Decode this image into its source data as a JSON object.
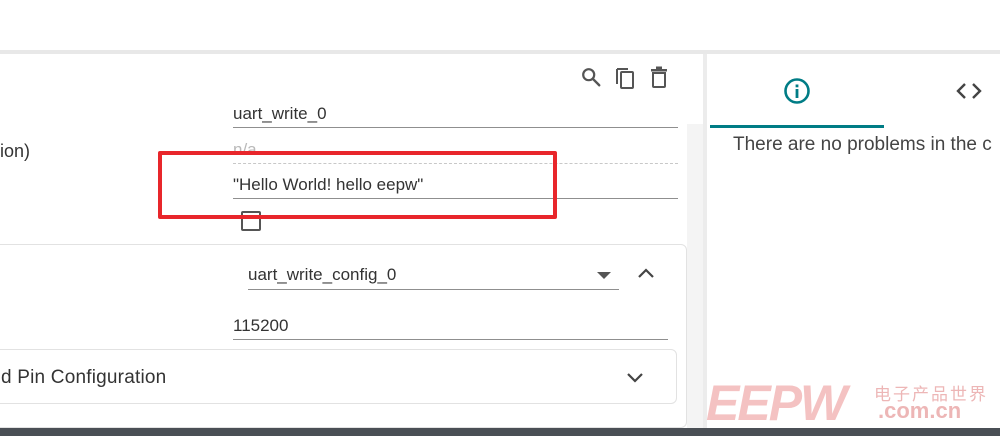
{
  "toolbar": {
    "icons": [
      "search-icon",
      "copy-icon",
      "delete-icon"
    ]
  },
  "form": {
    "partial_label": "ion)",
    "name_value": "uart_write_0",
    "readonly_value": "n/a",
    "string_value": "\"Hello World!  hello eepw\""
  },
  "config": {
    "selected_config": "uart_write_config_0",
    "baud_rate": "115200",
    "pin_section_label": "d Pin Configuration"
  },
  "right_panel": {
    "tabs": [
      "info-icon",
      "code-icon"
    ],
    "active_tab": "info-icon",
    "problems_message": "There are no problems in the c"
  },
  "watermark": {
    "brand": "EEPW",
    "chinese": "电子产品世界",
    "url": ".com.cn"
  },
  "colors": {
    "accent": "#007c85",
    "highlight": "#e8262b",
    "bottom_bar": "#4a4f55"
  }
}
